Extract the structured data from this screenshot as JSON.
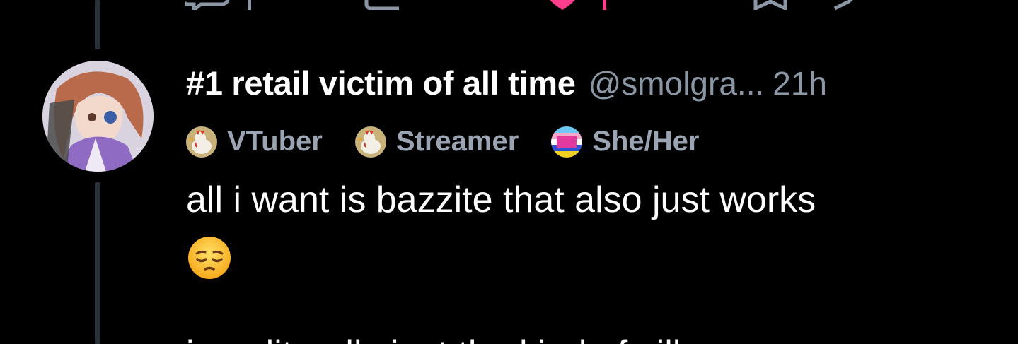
{
  "post": {
    "display_name": "#1 retail victim of all time",
    "handle": "@smolgra...",
    "timestamp": "21h",
    "text": "all i want is bazzite that also just works",
    "emoji": "pensive-face",
    "next_line": "i am literally just the kind of silly"
  },
  "badges": [
    {
      "label": "VTuber",
      "icon": "chicken-badge-icon"
    },
    {
      "label": "Streamer",
      "icon": "chicken-badge-icon"
    },
    {
      "label": "She/Her",
      "icon": "pronoun-flag-badge-icon"
    }
  ],
  "colors": {
    "background": "#000000",
    "muted_text": "#8c97a6",
    "thread_line": "#2a3038",
    "like_pink": "#ff3e8e"
  }
}
